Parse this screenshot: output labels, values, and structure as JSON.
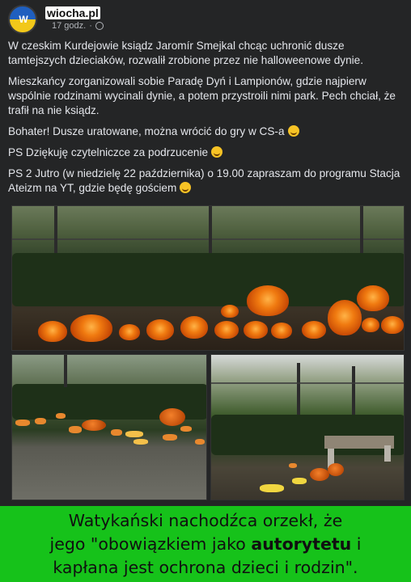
{
  "post": {
    "page_name": "wiocha.pl",
    "timestamp": "17 godz.",
    "paragraphs": [
      "W czeskim Kurdejowie ksiądz Jaromír Smejkal chcąc uchronić dusze tamtejszych dzieciaków, rozwalił zrobione przez nie halloweenowe dynie.",
      "Mieszkańcy zorganizowali sobie Paradę Dyń i Lampionów, gdzie najpierw wspólnie rodzinami wycinali dynie, a potem przystroili nimi park. Pech chciał, że trafił na nie ksiądz.",
      "Bohater! Dusze uratowane, można wrócić do gry w CS-a",
      "PS Dziękuję czytelniczce za podrzucenie",
      "PS 2 Jutro (w niedzielę 22 października) o 19.00 zapraszam do programu Stacja Ateizm na YT, gdzie będę gościem"
    ]
  },
  "caption": {
    "line1": "Watykański nachodźca orzekł, że",
    "line2_a": "jego \"obowiązkiem jako ",
    "line2_b": "autorytetu",
    "line2_c": " i",
    "line3": "kapłana jest ochrona dzieci i rodzin\"."
  },
  "colors": {
    "post_bg": "#242526",
    "caption_bg": "#16c21a",
    "pumpkin": "#f07a10"
  }
}
